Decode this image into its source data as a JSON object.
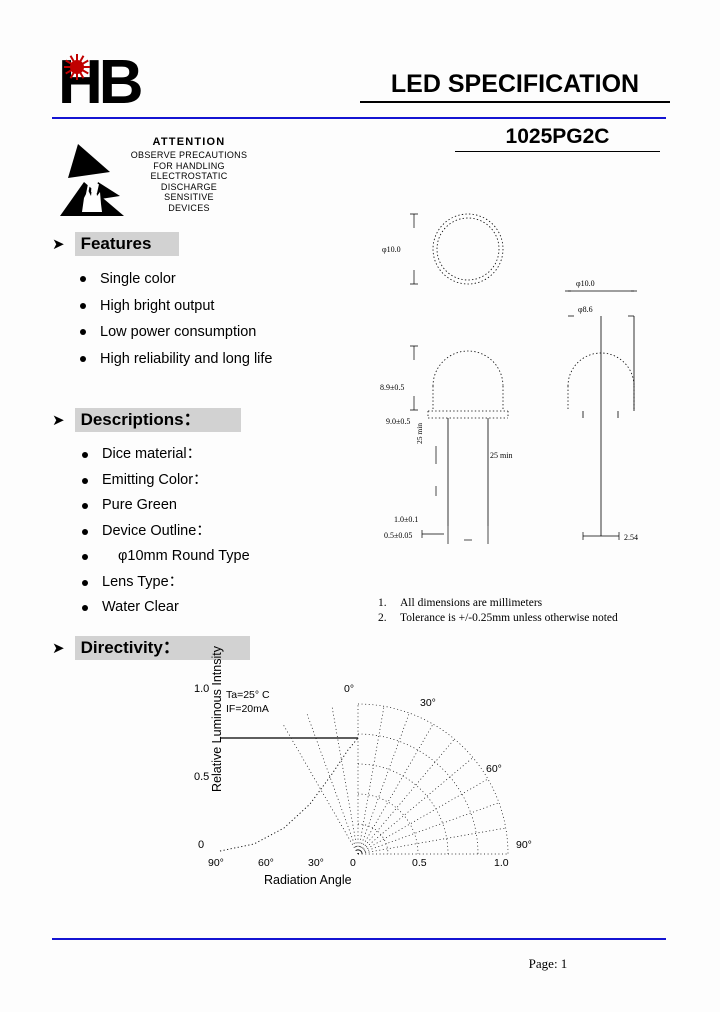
{
  "header": {
    "logo_text": "HB",
    "logo_icon": "red-sun-icon",
    "title": "LED SPECIFICATION",
    "part_number": "1025PG2C"
  },
  "esd_warning": {
    "title": "ATTENTION",
    "lines": [
      "OBSERVE PRECAUTIONS",
      "FOR HANDLING",
      "ELECTROSTATIC",
      "DISCHARGE",
      "SENSITIVE",
      "DEVICES"
    ],
    "symbol": "esd-hand-triangle-icon"
  },
  "features": {
    "heading": "Features",
    "arrow": "➤",
    "items": [
      "Single color",
      "High bright output",
      "Low power consumption",
      "High reliability and long life"
    ]
  },
  "descriptions": {
    "heading": "Descriptions：",
    "arrow": "➤",
    "items": [
      {
        "label": "Dice material：",
        "value": ""
      },
      {
        "label": "Emitting Color：",
        "value": "Pure Green"
      },
      {
        "label": "Device Outline：",
        "value": "φ10mm Round Type"
      },
      {
        "label": "Lens Type：",
        "value": "Water Clear"
      }
    ]
  },
  "drawing": {
    "notes": [
      {
        "num": "1.",
        "text": "All dimensions are millimeters"
      },
      {
        "num": "2.",
        "text": "Tolerance is  +/-0.25mm unless otherwise noted"
      }
    ],
    "dimension_labels": [
      "φ10.0",
      "φ8.6",
      "8.9±0.5",
      "9.0±0.5",
      "1.0",
      "25 min",
      "0.5±0.05",
      "2.54"
    ]
  },
  "directivity": {
    "heading": "Directivity：",
    "arrow": "➤"
  },
  "chart_data": {
    "type": "line",
    "title": "",
    "xlabel": "Radiation Angle",
    "ylabel": "Relative Luminous Intnsity",
    "conditions": [
      "Ta=25° C",
      "IF=20mA"
    ],
    "y_ticks": [
      "1.0",
      "0.5",
      "0"
    ],
    "y_values": [
      1.0,
      0.5,
      0
    ],
    "x_left_ticks": [
      "90°",
      "60°",
      "30°",
      "0"
    ],
    "x_right_ticks": [
      "0",
      "0.5",
      "1.0"
    ],
    "polar_angle_labels": [
      "0°",
      "30°",
      "60°",
      "90°"
    ],
    "polar_radius_labels": [
      "0",
      "0.5",
      "1.0"
    ],
    "ylim": [
      0,
      1.0
    ],
    "grid": true,
    "legend": "none",
    "series": [
      {
        "name": "Relative luminous intensity vs radiation angle",
        "angles_deg": [
          0,
          10,
          20,
          30,
          40,
          50,
          60,
          70,
          80,
          90
        ],
        "values": [
          1.0,
          0.97,
          0.9,
          0.78,
          0.62,
          0.45,
          0.3,
          0.17,
          0.07,
          0.0
        ]
      }
    ]
  },
  "footer": {
    "page_label": "Page: 1"
  },
  "colors": {
    "rule_blue": "#1414d2",
    "logo_red": "#c00000",
    "heading_highlight": "#d2d2d2"
  }
}
